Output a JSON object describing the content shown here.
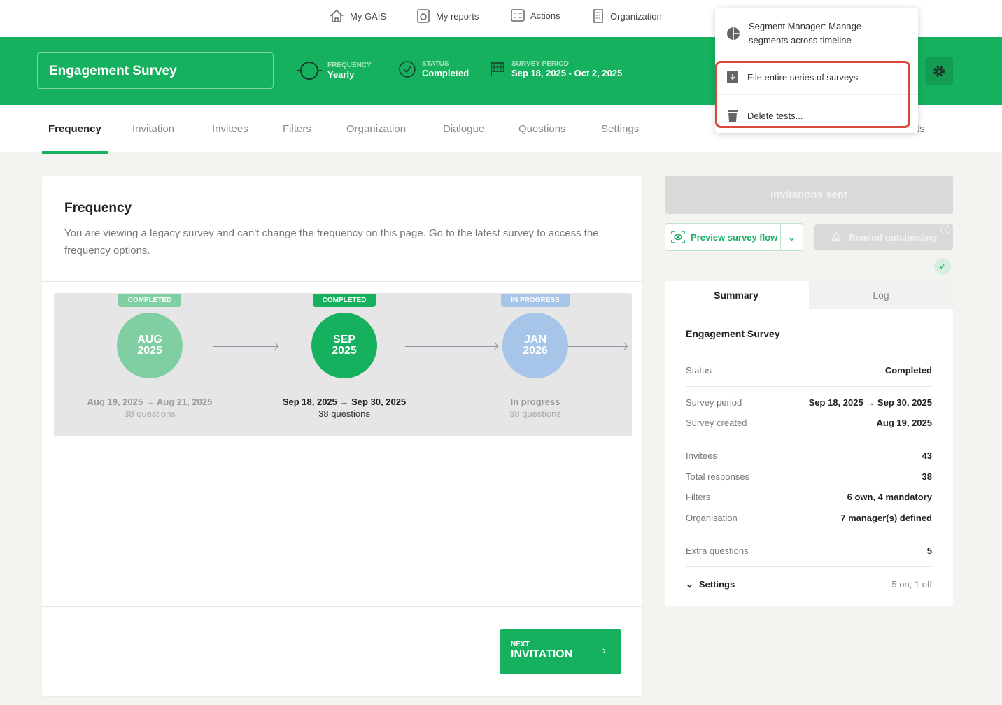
{
  "topnav": {
    "items": [
      {
        "label": "My GAIS",
        "icon": "home-icon"
      },
      {
        "label": "My reports",
        "icon": "reports-icon"
      },
      {
        "label": "Actions",
        "icon": "actions-icon"
      },
      {
        "label": "Organization",
        "icon": "building-icon"
      }
    ]
  },
  "header": {
    "title": "Engagement Survey",
    "frequency_label": "FREQUENCY",
    "frequency": "Yearly",
    "status_label": "STATUS",
    "status": "Completed",
    "period_label": "SURVEY PERIOD",
    "period": "Sep 18, 2025 - Oct 2, 2025"
  },
  "tabs": [
    "Frequency",
    "Invitation",
    "Invitees",
    "Filters",
    "Organization",
    "Dialogue",
    "Questions",
    "Settings"
  ],
  "tab_partial": "ts",
  "dropdown": {
    "items": [
      "Segment Manager: Manage segments across timeline",
      "File entire series of surveys",
      "Delete tests..."
    ]
  },
  "frequency": {
    "title": "Frequency",
    "description": "You are viewing a legacy survey and can't change the frequency on this page. Go to the latest survey to access the frequency options.",
    "nodes": [
      {
        "badge": "COMPLETED",
        "month": "AUG",
        "year": "2025",
        "dates": "Aug 19, 2025 → Aug 21, 2025",
        "questions": "38 questions"
      },
      {
        "badge": "COMPLETED",
        "month": "SEP",
        "year": "2025",
        "dates": "Sep 18, 2025 → Sep 30, 2025",
        "questions": "38 questions"
      },
      {
        "badge": "IN PROGRESS",
        "month": "JAN",
        "year": "2026",
        "dates": "In progress",
        "questions": "38 questions"
      }
    ],
    "next_small": "NEXT",
    "next_big": "INVITATION"
  },
  "actions": {
    "invitations_sent": "Invitations sent",
    "preview": "Preview survey flow",
    "remind": "Remind outstanding"
  },
  "summary": {
    "tabs": [
      "Summary",
      "Log"
    ],
    "title": "Engagement Survey",
    "rows": [
      {
        "k": "Status",
        "v": "Completed"
      },
      {
        "k": "Survey period",
        "v": "Sep 18, 2025 → Sep 30, 2025"
      },
      {
        "k": "Survey created",
        "v": "Aug 19, 2025"
      },
      {
        "k": "Invitees",
        "v": "43"
      },
      {
        "k": "Total responses",
        "v": "38"
      },
      {
        "k": "Filters",
        "v": "6 own, 4 mandatory"
      },
      {
        "k": "Organisation",
        "v": "7 manager(s) defined"
      },
      {
        "k": "Extra questions",
        "v": "5"
      }
    ],
    "settings_label": "Settings",
    "settings_value": "5 on, 1 off"
  },
  "colors": {
    "brand": "#16b15e",
    "highlight": "#d9473a"
  }
}
